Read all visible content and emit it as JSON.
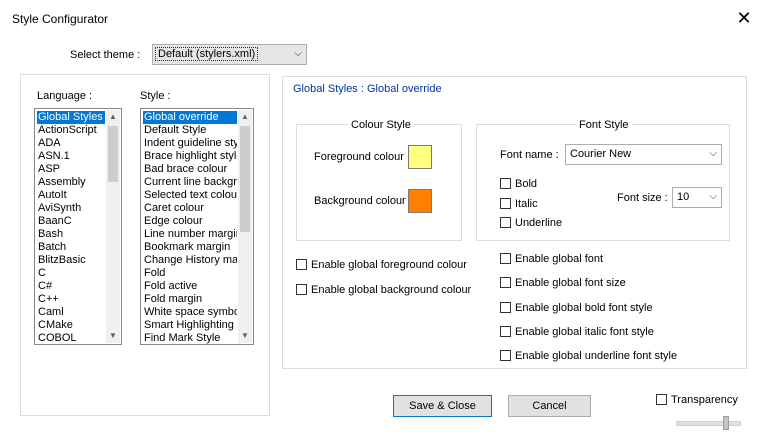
{
  "window": {
    "title": "Style Configurator",
    "close_glyph": "✕"
  },
  "theme": {
    "label": "Select theme :",
    "value": "Default (stylers.xml)"
  },
  "language": {
    "label": "Language :",
    "items": [
      "Global Styles",
      "ActionScript",
      "ADA",
      "ASN.1",
      "ASP",
      "Assembly",
      "AutoIt",
      "AviSynth",
      "BaanC",
      "Bash",
      "Batch",
      "BlitzBasic",
      "C",
      "C#",
      "C++",
      "Caml",
      "CMake",
      "COBOL"
    ],
    "selected_index": 0
  },
  "style": {
    "label": "Style :",
    "items": [
      "Global override",
      "Default Style",
      "Indent guideline style",
      "Brace highlight style",
      "Bad brace colour",
      "Current line background",
      "Selected text colour",
      "Caret colour",
      "Edge colour",
      "Line number margin",
      "Bookmark margin",
      "Change History margin",
      "Fold",
      "Fold active",
      "Fold margin",
      "White space symbol",
      "Smart Highlighting",
      "Find Mark Style"
    ],
    "selected_index": 0
  },
  "panel_title": "Global Styles : Global override",
  "colour_style": {
    "title": "Colour Style",
    "foreground_label": "Foreground colour",
    "background_label": "Background colour",
    "foreground_color": "#ffff80",
    "background_color": "#ff8000"
  },
  "font_style": {
    "title": "Font Style",
    "font_name_label": "Font name :",
    "font_name_value": "Courier New",
    "bold_label": "Bold",
    "italic_label": "Italic",
    "underline_label": "Underline",
    "font_size_label": "Font size :",
    "font_size_value": "10"
  },
  "checks": {
    "global_fg": "Enable global foreground colour",
    "global_bg": "Enable global background colour",
    "global_font": "Enable global font",
    "global_font_size": "Enable global font size",
    "global_bold": "Enable global bold font style",
    "global_italic": "Enable global italic font style",
    "global_underline": "Enable global underline font style"
  },
  "buttons": {
    "save_close": "Save & Close",
    "cancel": "Cancel"
  },
  "transparency": {
    "label": "Transparency"
  },
  "colors": {
    "accent": "#0078d7",
    "title_blue": "#0033aa"
  }
}
